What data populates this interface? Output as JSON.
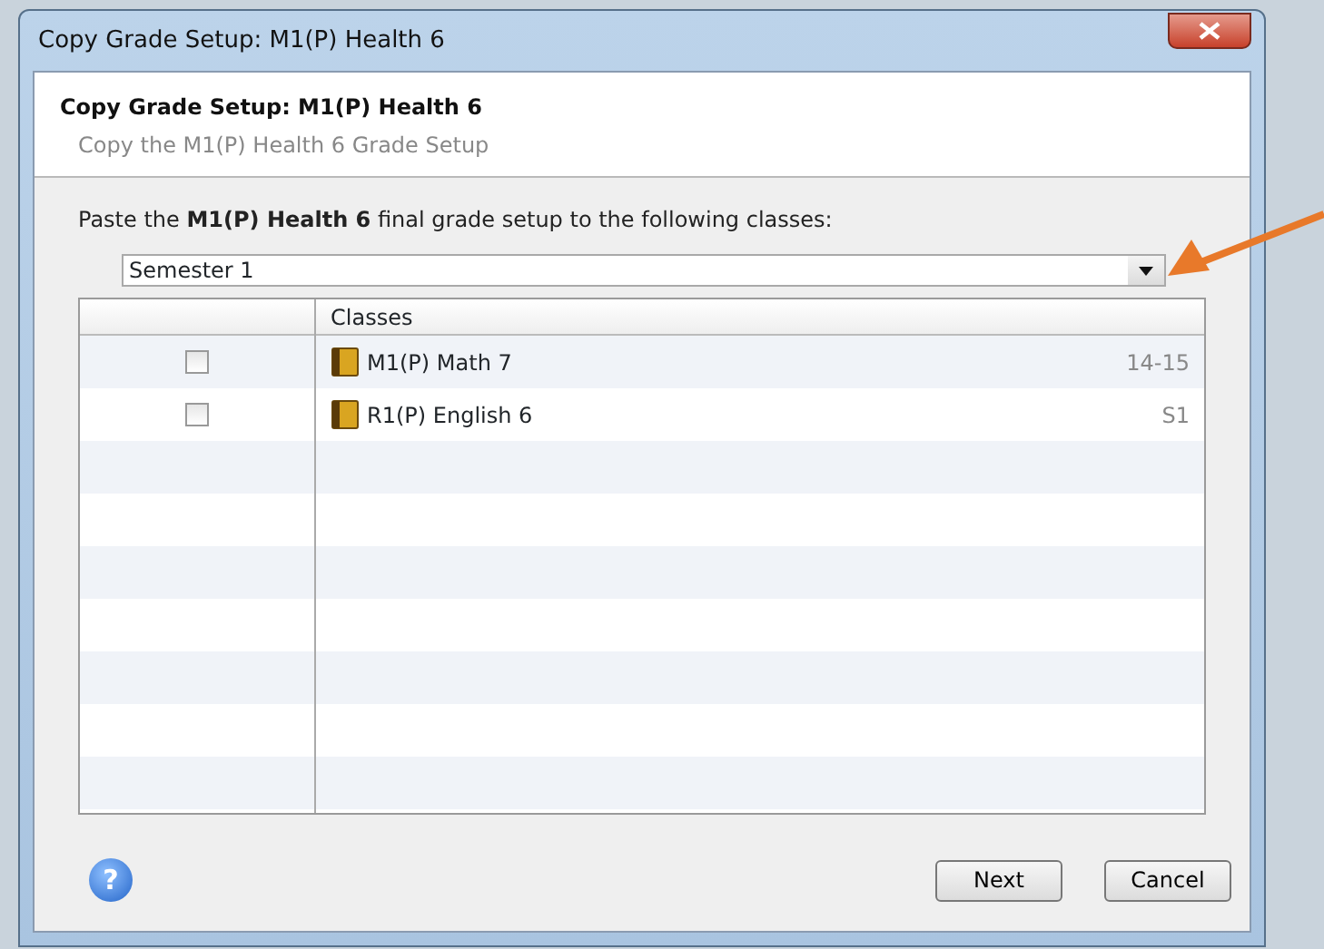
{
  "window": {
    "title": "Copy Grade Setup: M1(P) Health 6"
  },
  "header": {
    "title": "Copy Grade Setup: M1(P) Health 6",
    "subtitle": "Copy the M1(P) Health 6 Grade Setup"
  },
  "instruction": "Paste the **M1(P) Health 6** final grade setup to the following classes:",
  "term_select": {
    "value": "Semester 1"
  },
  "table": {
    "columns": [
      "Classes"
    ],
    "rows": [
      {
        "checked": false,
        "name": "M1(P) Math 7",
        "term": "14-15"
      },
      {
        "checked": false,
        "name": "R1(P) English 6",
        "term": "S1"
      }
    ]
  },
  "help": {
    "label": "?"
  },
  "buttons": [
    "Next",
    "Cancel"
  ]
}
